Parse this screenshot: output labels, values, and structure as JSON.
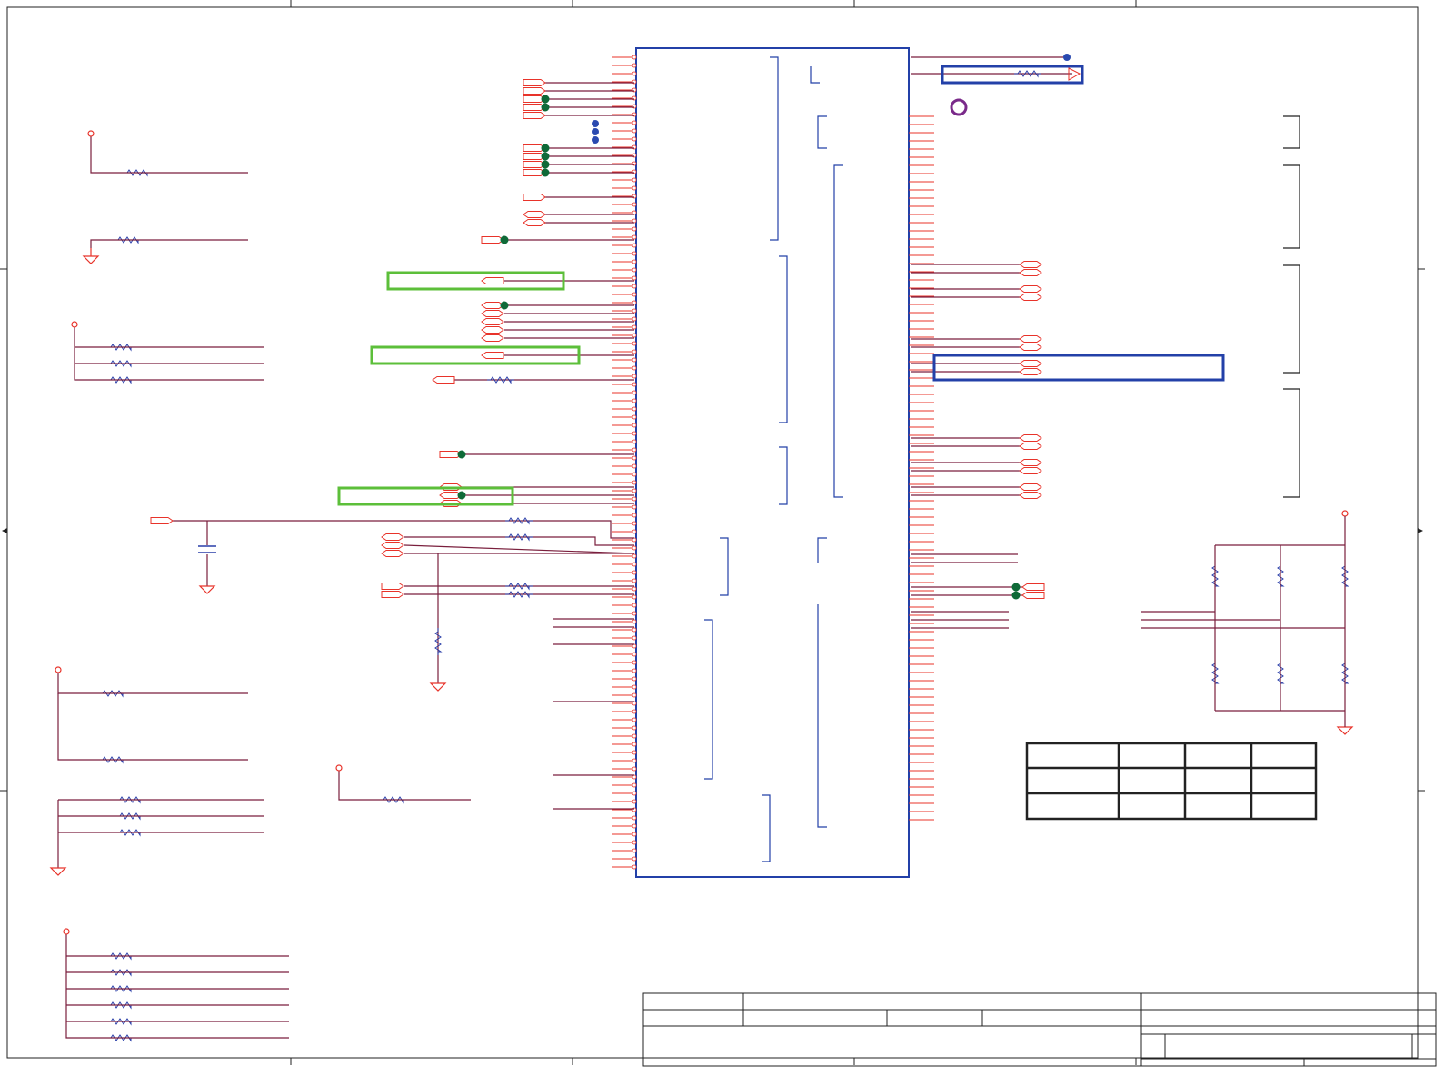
{
  "sheet": {
    "title": "",
    "colors": {
      "wire": "#7a1f3d",
      "pin": "#e8332a",
      "chip": "#2340a8",
      "junction": "#0f6a38",
      "blue_dot": "#2a4ab0",
      "highlight_green": "#5cbf3a",
      "highlight_blue": "#2340a8",
      "marker_purple": "#7a2a8a",
      "frame": "#222222",
      "resistor": "#2a3ea8"
    }
  },
  "schematic": {
    "main_ic": {
      "label": ""
    },
    "callout_table": {
      "header": [
        "",
        "",
        "",
        ""
      ],
      "rows": [
        [
          "",
          "",
          "",
          ""
        ],
        [
          "",
          "",
          "",
          ""
        ]
      ]
    },
    "title_block": {
      "title": "",
      "size": "",
      "document_number": "",
      "rev": "",
      "date": "",
      "sheet": ""
    }
  }
}
